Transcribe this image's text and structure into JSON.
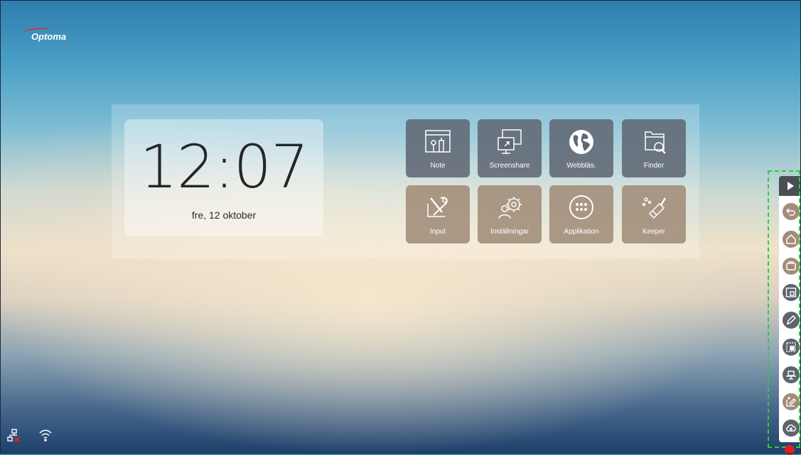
{
  "brand": {
    "logo_text": "Optoma",
    "swoosh_color": "#e8262a"
  },
  "clock": {
    "time": "12:07",
    "date": "fre, 12 oktober"
  },
  "apps": [
    {
      "label": "Note",
      "icon": "note-icon",
      "style": "dark"
    },
    {
      "label": "Screenshare",
      "icon": "screenshare-icon",
      "style": "dark"
    },
    {
      "label": "Webbläs.",
      "icon": "globe-icon",
      "style": "dark"
    },
    {
      "label": "Finder",
      "icon": "folder-search-icon",
      "style": "dark"
    },
    {
      "label": "Input",
      "icon": "input-tools-icon",
      "style": "brown"
    },
    {
      "label": "Inställningar",
      "icon": "settings-gear-person-icon",
      "style": "brown"
    },
    {
      "label": "Applikation",
      "icon": "apps-grid-icon",
      "style": "brown"
    },
    {
      "label": "Keeper",
      "icon": "broom-icon",
      "style": "brown"
    }
  ],
  "sidebar_toolbar": {
    "toggle_icon": "play-arrow-icon",
    "buttons": [
      {
        "icon": "back-icon",
        "style": "brown"
      },
      {
        "icon": "home-icon",
        "style": "brown"
      },
      {
        "icon": "recent-apps-icon",
        "style": "brown"
      },
      {
        "icon": "whiteboard-icon",
        "style": "dark"
      },
      {
        "icon": "annotate-pen-icon",
        "style": "dark"
      },
      {
        "icon": "screen-capture-icon",
        "style": "dark"
      },
      {
        "icon": "freeze-icon",
        "style": "dark"
      },
      {
        "icon": "clean-icon",
        "style": "brown"
      },
      {
        "icon": "cloud-upload-icon",
        "style": "dark"
      }
    ]
  },
  "status_bar": {
    "icons": [
      "network-disconnected-icon",
      "wifi-icon"
    ]
  },
  "colors": {
    "tile_dark": "#606874",
    "tile_brown": "#a08c78",
    "highlight": "#2ecc40"
  }
}
